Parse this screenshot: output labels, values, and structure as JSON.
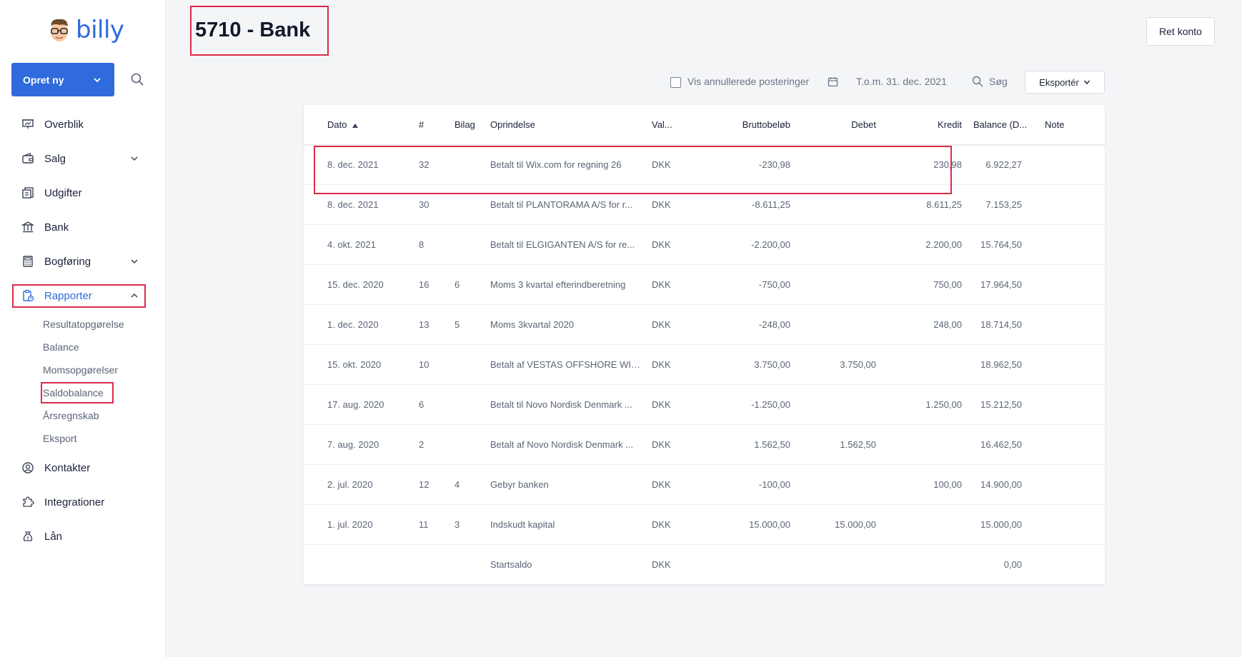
{
  "brand": {
    "name": "billy"
  },
  "sidebar": {
    "create_label": "Opret ny",
    "items": [
      {
        "label": "Overblik",
        "icon": "presentation-icon"
      },
      {
        "label": "Salg",
        "icon": "wallet-icon"
      },
      {
        "label": "Udgifter",
        "icon": "receipt-icon"
      },
      {
        "label": "Bank",
        "icon": "bank-icon"
      },
      {
        "label": "Bogføring",
        "icon": "calculator-icon"
      },
      {
        "label": "Rapporter",
        "icon": "report-icon"
      },
      {
        "label": "Kontakter",
        "icon": "contact-icon"
      },
      {
        "label": "Integrationer",
        "icon": "puzzle-icon"
      },
      {
        "label": "Lån",
        "icon": "money-bag-icon"
      }
    ],
    "reports_sub": [
      "Resultatopgørelse",
      "Balance",
      "Momsopgørelser",
      "Saldobalance",
      "Årsregnskab",
      "Eksport"
    ]
  },
  "header": {
    "title": "5710 - Bank",
    "edit_label": "Ret konto"
  },
  "toolbar": {
    "show_voided_label": "Vis annullerede posteringer",
    "date_filter": "T.o.m. 31. dec. 2021",
    "search_label": "Søg",
    "export_label": "Eksportér"
  },
  "table": {
    "columns": [
      "Dato",
      "#",
      "Bilag",
      "Oprindelse",
      "Val...",
      "Bruttobeløb",
      "Debet",
      "Kredit",
      "Balance (D...",
      "Note"
    ],
    "rows": [
      {
        "date": "8. dec. 2021",
        "num": "32",
        "voucher": "",
        "origin": "Betalt til Wix.com for regning 26",
        "currency": "DKK",
        "gross": "-230,98",
        "debit": "",
        "credit": "230,98",
        "balance": "6.922,27",
        "note": ""
      },
      {
        "date": "8. dec. 2021",
        "num": "30",
        "voucher": "",
        "origin": "Betalt til PLANTORAMA A/S for r...",
        "currency": "DKK",
        "gross": "-8.611,25",
        "debit": "",
        "credit": "8.611,25",
        "balance": "7.153,25",
        "note": ""
      },
      {
        "date": "4. okt. 2021",
        "num": "8",
        "voucher": "",
        "origin": "Betalt til ELGIGANTEN A/S for re...",
        "currency": "DKK",
        "gross": "-2.200,00",
        "debit": "",
        "credit": "2.200,00",
        "balance": "15.764,50",
        "note": ""
      },
      {
        "date": "15. dec. 2020",
        "num": "16",
        "voucher": "6",
        "origin": "Moms 3 kvartal efterindberetning",
        "currency": "DKK",
        "gross": "-750,00",
        "debit": "",
        "credit": "750,00",
        "balance": "17.964,50",
        "note": ""
      },
      {
        "date": "1. dec. 2020",
        "num": "13",
        "voucher": "5",
        "origin": "Moms 3kvartal 2020",
        "currency": "DKK",
        "gross": "-248,00",
        "debit": "",
        "credit": "248,00",
        "balance": "18.714,50",
        "note": ""
      },
      {
        "date": "15. okt. 2020",
        "num": "10",
        "voucher": "",
        "origin": "Betalt af VESTAS OFFSHORE WIN...",
        "currency": "DKK",
        "gross": "3.750,00",
        "debit": "3.750,00",
        "credit": "",
        "balance": "18.962,50",
        "note": ""
      },
      {
        "date": "17. aug. 2020",
        "num": "6",
        "voucher": "",
        "origin": "Betalt til Novo Nordisk Denmark ...",
        "currency": "DKK",
        "gross": "-1.250,00",
        "debit": "",
        "credit": "1.250,00",
        "balance": "15.212,50",
        "note": ""
      },
      {
        "date": "7. aug. 2020",
        "num": "2",
        "voucher": "",
        "origin": "Betalt af Novo Nordisk Denmark ...",
        "currency": "DKK",
        "gross": "1.562,50",
        "debit": "1.562,50",
        "credit": "",
        "balance": "16.462,50",
        "note": ""
      },
      {
        "date": "2. jul. 2020",
        "num": "12",
        "voucher": "4",
        "origin": "Gebyr banken",
        "currency": "DKK",
        "gross": "-100,00",
        "debit": "",
        "credit": "100,00",
        "balance": "14.900,00",
        "note": ""
      },
      {
        "date": "1. jul. 2020",
        "num": "11",
        "voucher": "3",
        "origin": "Indskudt kapital",
        "currency": "DKK",
        "gross": "15.000,00",
        "debit": "15.000,00",
        "credit": "",
        "balance": "15.000,00",
        "note": ""
      },
      {
        "date": "",
        "num": "",
        "voucher": "",
        "origin": "Startsaldo",
        "currency": "DKK",
        "gross": "",
        "debit": "",
        "credit": "",
        "balance": "0,00",
        "note": ""
      }
    ]
  },
  "colors": {
    "accent": "#2f6bdc",
    "highlight": "#dc2a4a"
  }
}
